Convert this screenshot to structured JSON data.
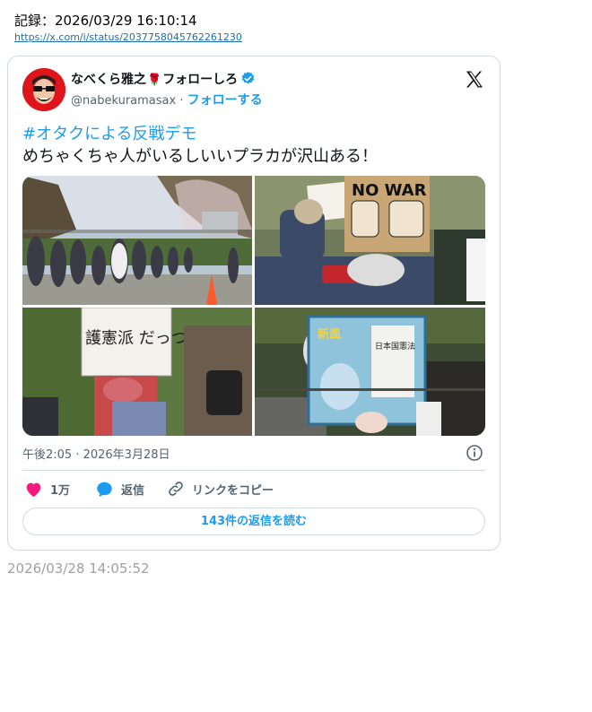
{
  "record": {
    "label": "記録：2026/03/29 16:10:14",
    "url": "https://x.com/i/status/2037758045762261230"
  },
  "tweet": {
    "author": {
      "name_prefix": "なべくら雅之",
      "rose_glyph": "🌹",
      "name_suffix": "フォローしろ",
      "handle": "@nabekuramasax",
      "separator": " · ",
      "follow_label": "フォローする",
      "verified": true
    },
    "hashtag": "#オタクによる反戦デモ",
    "text": "めちゃくちゃ人がいるしいいプラカが沢山ある！",
    "images": [
      {
        "name": "line-of-people-photo",
        "text": ""
      },
      {
        "name": "no-war-sign-photo",
        "text": "NO WAR"
      },
      {
        "name": "handwritten-sign-photo",
        "text": "護憲派 だっつーの"
      },
      {
        "name": "book-cover-photo",
        "text": "日本国憲法"
      }
    ],
    "timestamp": "午後2:05 · 2026年3月28日",
    "actions": {
      "like_count": "1万",
      "reply_label": "返信",
      "copy_link_label": "リンクをコピー"
    },
    "read_replies_label": "143件の返信を読む"
  },
  "post_time": "2026/03/28 14:05:52",
  "colors": {
    "accent": "#1d9bf0",
    "like": "#f91880",
    "secondary_text": "#536471",
    "border": "#cfd9de"
  },
  "icons": [
    "avatar",
    "verified-badge-icon",
    "x-logo-icon",
    "info-icon",
    "heart-icon",
    "reply-bubble-icon",
    "link-icon"
  ]
}
